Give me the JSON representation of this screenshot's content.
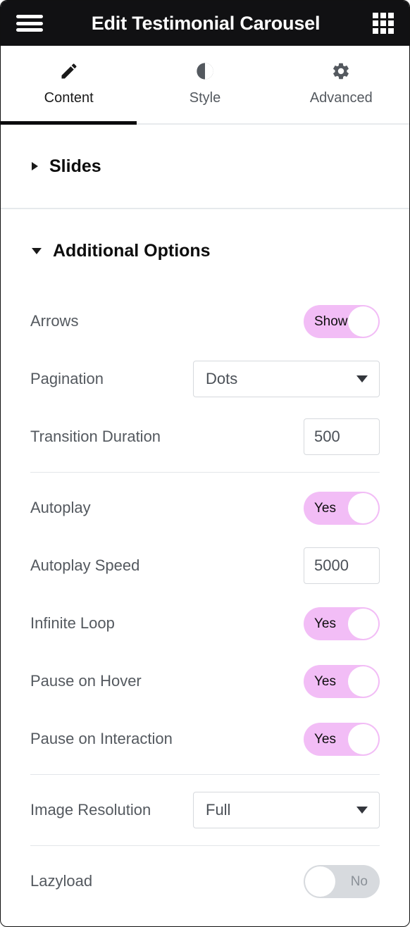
{
  "header": {
    "title": "Edit Testimonial Carousel",
    "menu_icon": "hamburger-menu-icon",
    "apps_icon": "grid-apps-icon"
  },
  "tabs": [
    {
      "label": "Content",
      "icon": "pencil-icon",
      "active": true
    },
    {
      "label": "Style",
      "icon": "contrast-icon",
      "active": false
    },
    {
      "label": "Advanced",
      "icon": "gear-icon",
      "active": false
    }
  ],
  "sections": [
    {
      "title": "Slides",
      "expanded": false
    },
    {
      "title": "Additional Options",
      "expanded": true
    }
  ],
  "controls": {
    "arrows": {
      "label": "Arrows",
      "value": "Show",
      "state": "on"
    },
    "pagination": {
      "label": "Pagination",
      "value": "Dots"
    },
    "transition_duration": {
      "label": "Transition Duration",
      "value": "500"
    },
    "autoplay": {
      "label": "Autoplay",
      "value": "Yes",
      "state": "on"
    },
    "autoplay_speed": {
      "label": "Autoplay Speed",
      "value": "5000"
    },
    "infinite_loop": {
      "label": "Infinite Loop",
      "value": "Yes",
      "state": "on"
    },
    "pause_on_hover": {
      "label": "Pause on Hover",
      "value": "Yes",
      "state": "on"
    },
    "pause_on_interaction": {
      "label": "Pause on Interaction",
      "value": "Yes",
      "state": "on"
    },
    "image_resolution": {
      "label": "Image Resolution",
      "value": "Full"
    },
    "lazyload": {
      "label": "Lazyload",
      "value": "No",
      "state": "off"
    }
  },
  "colors": {
    "header_bg": "#111113",
    "toggle_on": "#f2bdf6",
    "toggle_off": "#d7dade",
    "label_text": "#54595f",
    "active_tab_underline": "#0b0b0d"
  }
}
